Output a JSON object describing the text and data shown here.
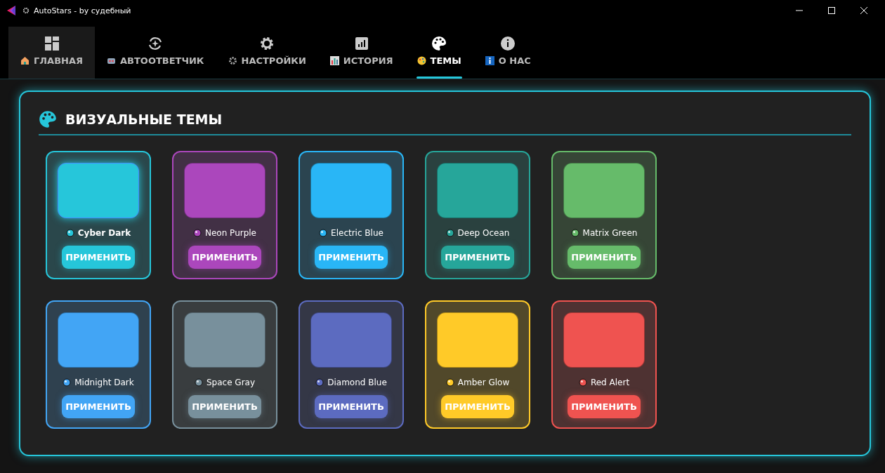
{
  "window": {
    "title": "AutoStars - by судебный"
  },
  "tabs": [
    {
      "label": "ГЛАВНАЯ",
      "selected": false,
      "highlighted": true
    },
    {
      "label": "АВТООТВЕТЧИК",
      "selected": false,
      "highlighted": false
    },
    {
      "label": "НАСТРОЙКИ",
      "selected": false,
      "highlighted": false
    },
    {
      "label": "ИСТОРИЯ",
      "selected": false,
      "highlighted": false
    },
    {
      "label": "ТЕМЫ",
      "selected": true,
      "highlighted": false
    },
    {
      "label": "О НАС",
      "selected": false,
      "highlighted": false
    }
  ],
  "panel": {
    "title": "ВИЗУАЛЬНЫЕ ТЕМЫ"
  },
  "themes": [
    {
      "name": "Cyber Dark",
      "color": "#26c6da",
      "selected": true,
      "button": "ПРИМЕНИТЬ"
    },
    {
      "name": "Neon Purple",
      "color": "#ab47bc",
      "selected": false,
      "button": "ПРИМЕНИТЬ"
    },
    {
      "name": "Electric Blue",
      "color": "#29b6f6",
      "selected": false,
      "button": "ПРИМЕНИТЬ"
    },
    {
      "name": "Deep Ocean",
      "color": "#26a69a",
      "selected": false,
      "button": "ПРИМЕНИТЬ"
    },
    {
      "name": "Matrix Green",
      "color": "#66bb6a",
      "selected": false,
      "button": "ПРИМЕНИТЬ"
    },
    {
      "name": "Midnight Dark",
      "color": "#42a5f5",
      "selected": false,
      "button": "ПРИМЕНИТЬ"
    },
    {
      "name": "Space Gray",
      "color": "#78909c",
      "selected": false,
      "button": "ПРИМЕНИТЬ"
    },
    {
      "name": "Diamond Blue",
      "color": "#5c6bc0",
      "selected": false,
      "button": "ПРИМЕНИТЬ"
    },
    {
      "name": "Amber Glow",
      "color": "#ffca28",
      "selected": false,
      "button": "ПРИМЕНИТЬ"
    },
    {
      "name": "Red Alert",
      "color": "#ef5350",
      "selected": false,
      "button": "ПРИМЕНИТЬ"
    }
  ]
}
